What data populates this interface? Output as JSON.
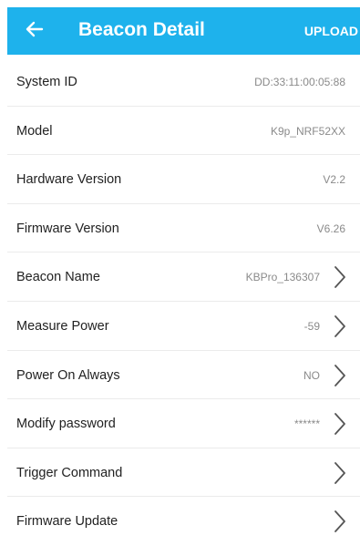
{
  "header": {
    "title": "Beacon Detail",
    "upload_label": "UPLOAD",
    "back_icon": "arrow-left-icon",
    "background_color": "#1eb2ec"
  },
  "rows": [
    {
      "label": "System ID",
      "value": "DD:33:11:00:05:88",
      "chevron": false
    },
    {
      "label": "Model",
      "value": "K9p_NRF52XX",
      "chevron": false
    },
    {
      "label": "Hardware Version",
      "value": "V2.2",
      "chevron": false
    },
    {
      "label": "Firmware Version",
      "value": "V6.26",
      "chevron": false
    },
    {
      "label": "Beacon Name",
      "value": "KBPro_136307",
      "chevron": true
    },
    {
      "label": "Measure Power",
      "value": "-59",
      "chevron": true
    },
    {
      "label": "Power On Always",
      "value": "NO",
      "chevron": true
    },
    {
      "label": "Modify password",
      "value": "******",
      "chevron": true
    },
    {
      "label": "Trigger Command",
      "value": "",
      "chevron": true
    },
    {
      "label": "Firmware Update",
      "value": "",
      "chevron": true
    }
  ]
}
